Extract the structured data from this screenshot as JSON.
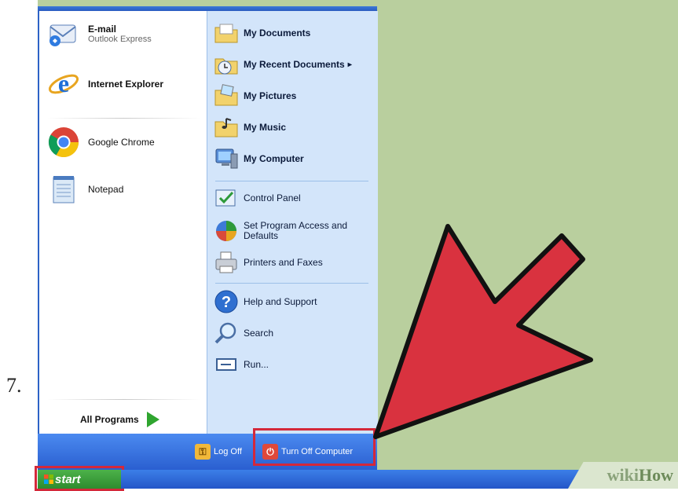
{
  "step_number": "7.",
  "pinned": [
    {
      "label": "E-mail",
      "sub": "Outlook Express",
      "icon": "email-icon"
    },
    {
      "label": "Internet Explorer",
      "icon": "internet-explorer-icon"
    }
  ],
  "recent": [
    {
      "label": "Google Chrome",
      "icon": "chrome-icon"
    },
    {
      "label": "Notepad",
      "icon": "notepad-icon"
    }
  ],
  "all_programs": "All Programs",
  "places": [
    {
      "label": "My Documents",
      "icon": "folder-documents-icon"
    },
    {
      "label": "My Recent Documents",
      "icon": "recent-documents-icon",
      "submenu": "▸"
    },
    {
      "label": "My Pictures",
      "icon": "folder-pictures-icon"
    },
    {
      "label": "My Music",
      "icon": "folder-music-icon"
    },
    {
      "label": "My Computer",
      "icon": "computer-icon"
    }
  ],
  "settings": [
    {
      "label": "Control Panel",
      "icon": "control-panel-icon"
    },
    {
      "label": "Set Program Access and Defaults",
      "icon": "program-access-icon"
    },
    {
      "label": "Printers and Faxes",
      "icon": "printer-icon"
    }
  ],
  "help": [
    {
      "label": "Help and Support",
      "icon": "help-icon"
    },
    {
      "label": "Search",
      "icon": "search-icon"
    },
    {
      "label": "Run...",
      "icon": "run-icon"
    }
  ],
  "bottom": {
    "log_off": "Log Off",
    "turn_off": "Turn Off Computer"
  },
  "taskbar": {
    "start": "start"
  },
  "watermark": {
    "wiki": "wiki",
    "how": "How"
  },
  "colors": {
    "highlight": "#d4283a",
    "desktop": "#b9cf9e",
    "taskbar": "#2456c8",
    "start_green": "#3a9c38",
    "arrow": "#d9323f"
  }
}
